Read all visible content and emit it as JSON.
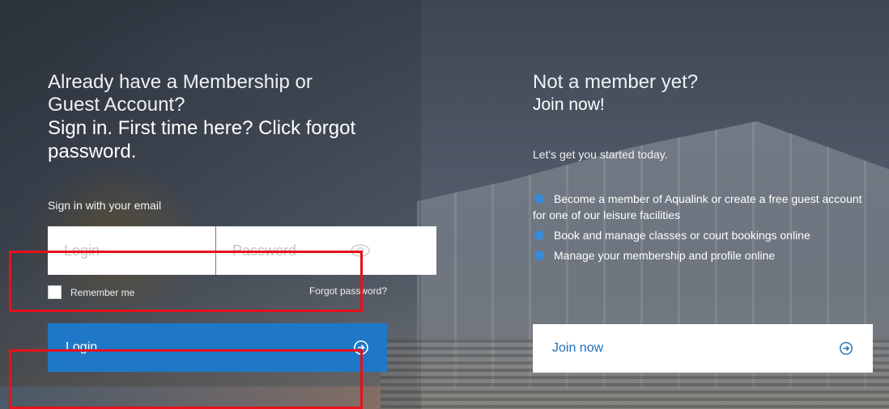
{
  "signin": {
    "heading_line1": "Already have a Membership or",
    "heading_line2": "Guest Account?",
    "heading_bold_line1": "Sign in. First time here? Click forgot",
    "heading_bold_line2": "password.",
    "email_label": "Sign in with your email",
    "login_placeholder": "Login",
    "password_placeholder": "Password",
    "remember_label": "Remember me",
    "forgot_link": "Forgot password?",
    "login_button": "Login"
  },
  "join": {
    "heading_light": "Not a member yet?",
    "heading_bold": "Join now!",
    "tagline": "Let's get you started today.",
    "benefits": [
      "Become a member of Aqualink or create a free guest account for one of our leisure facilities",
      "Book and manage classes or court bookings online",
      "Manage your membership and profile online"
    ],
    "join_button": "Join now"
  },
  "colors": {
    "primary_blue": "#1f78c7",
    "highlight_red": "#e8101a",
    "white": "#ffffff"
  },
  "icons": {
    "password_toggle": "eye-icon",
    "button_arrow": "arrow-circle-right-icon",
    "benefit_bullet": "blue-circle-icon"
  }
}
